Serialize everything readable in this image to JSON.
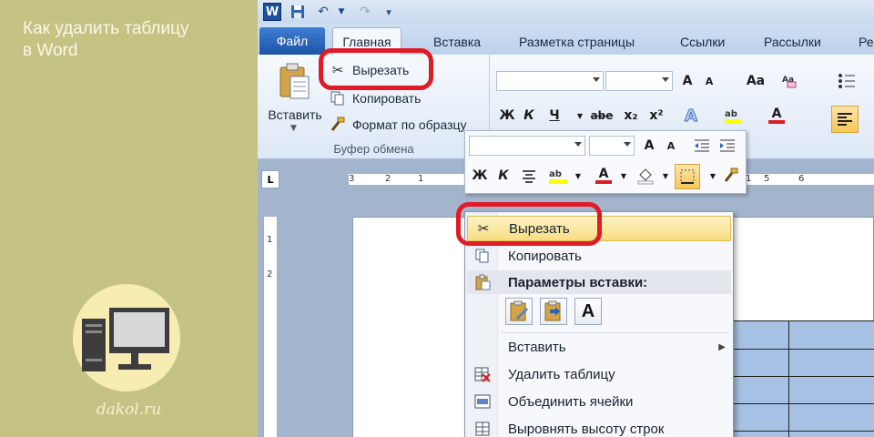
{
  "article": {
    "title": "Как удалить таблицу\nв Word",
    "site": "dakol.ru"
  },
  "app": {
    "qat": {
      "word_icon": "W",
      "undo_icon": "↶",
      "redo_icon": "↷",
      "save_icon": "save-icon"
    },
    "tabs": [
      {
        "label": "Файл"
      },
      {
        "label": "Главная"
      },
      {
        "label": "Вставка"
      },
      {
        "label": "Разметка страницы"
      },
      {
        "label": "Ссылки"
      },
      {
        "label": "Рассылки"
      },
      {
        "label": "Ре"
      }
    ],
    "clipboard": {
      "paste_label": "Вставить",
      "cut_label": "Вырезать",
      "copy_label": "Копировать",
      "format_painter_label": "Формат по образцу",
      "group_label": "Буфер обмена"
    },
    "font": {
      "grow": "A",
      "shrink": "A",
      "case": "Aa",
      "bold": "Ж",
      "italic": "К",
      "underline": "Ч",
      "strike": "abe",
      "subscript": "x₂",
      "superscript": "x²",
      "color_letter": "A"
    },
    "ruler": {
      "numbers_h": [
        "3",
        "2",
        "1",
        "1",
        "5",
        "6"
      ],
      "numbers_v": [
        "1",
        "2"
      ]
    },
    "mini_toolbar": {
      "grow": "A",
      "shrink": "A",
      "bold": "Ж",
      "italic": "К",
      "color_letter": "A"
    },
    "context_menu": {
      "cut": "Вырезать",
      "copy": "Копировать",
      "paste_options": "Параметры вставки:",
      "paste_opt_text": "A",
      "insert": "Вставить",
      "delete_table": "Удалить таблицу",
      "merge_cells": "Объединить ячейки",
      "distribute_rows": "Выровнять высоту строк"
    }
  },
  "colors": {
    "highlight": "#e01a26",
    "accent_file_tab": "#2a62b8",
    "table_fill": "#a6c1e4",
    "left_panel": "#c5c383"
  }
}
